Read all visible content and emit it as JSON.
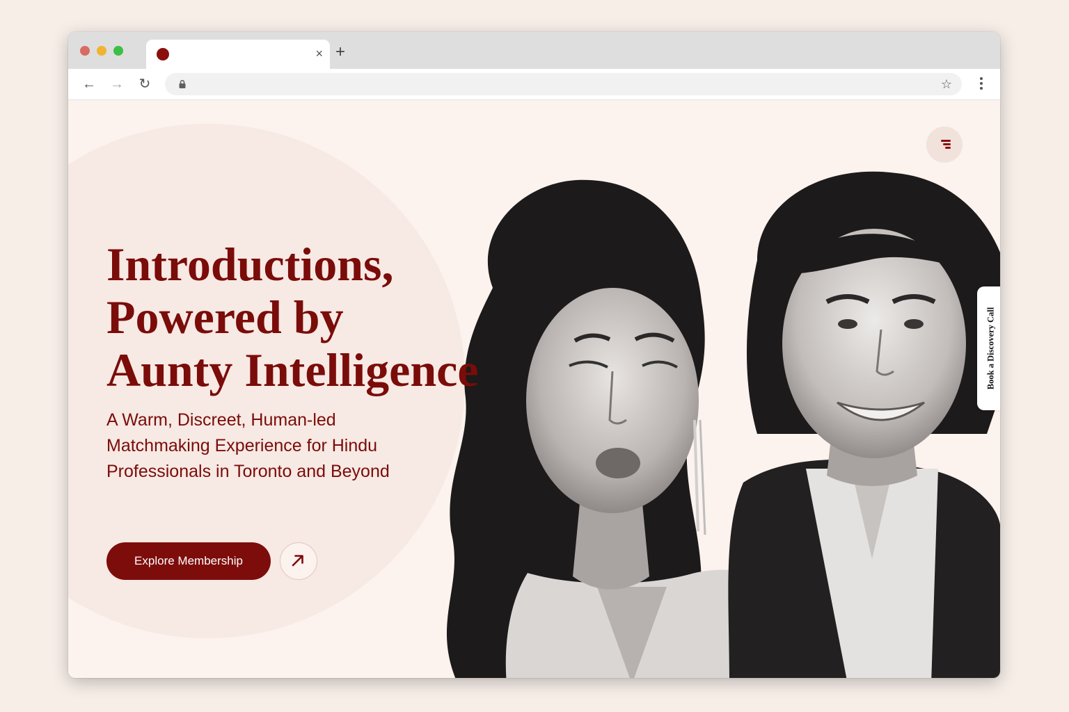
{
  "browser": {
    "tab_close": "×",
    "new_tab": "+",
    "back": "←",
    "forward": "→",
    "reload": "↻",
    "bookmark_star": "☆",
    "address": ""
  },
  "hero": {
    "headline_lines": [
      "Introductions,",
      "Powered by",
      "Aunty Intelligence"
    ],
    "subheading": "A Warm, Discreet, Human-led Matchmaking Experience for Hindu Professionals in Toronto and Beyond",
    "cta_label": "Explore Membership"
  },
  "side_tab": {
    "label": "Book a Discovery Call"
  },
  "colors": {
    "brand_maroon": "#7a0c0a",
    "page_background": "#fcf2ee",
    "button_background": "#7d0d0b"
  },
  "icons": {
    "menu": "hamburger-menu-icon",
    "cta_arrow": "arrow-up-right-icon",
    "favicon": "site-favicon-icon",
    "lock": "lock-icon"
  }
}
